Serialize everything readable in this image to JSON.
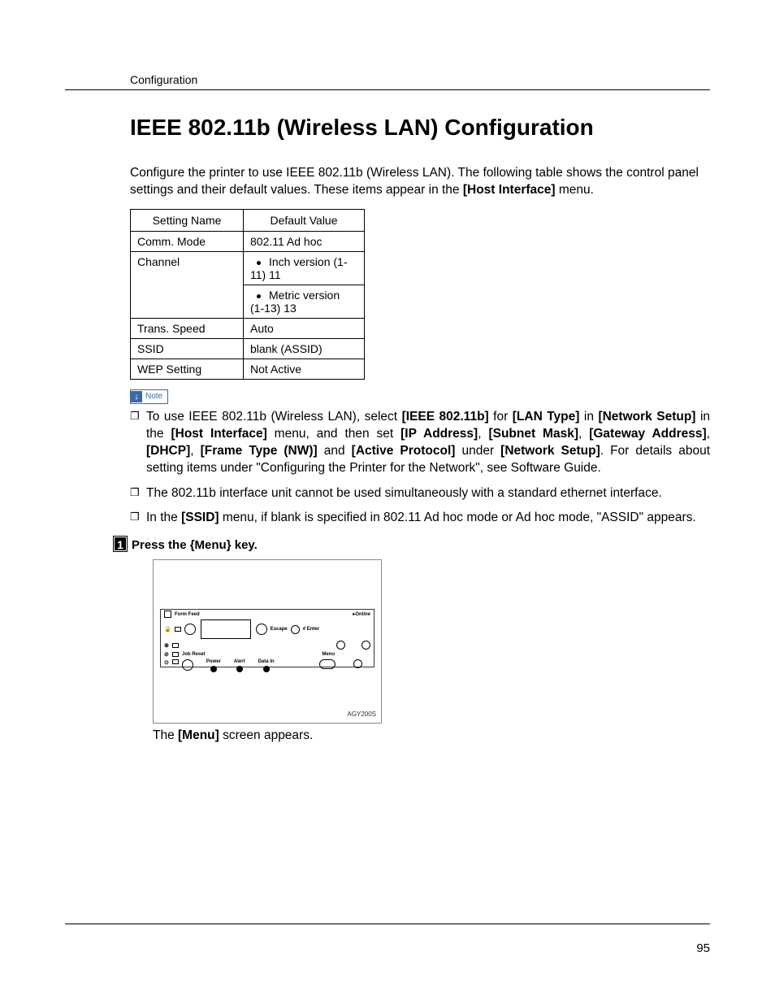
{
  "header": {
    "section": "Configuration"
  },
  "title": "IEEE 802.11b (Wireless LAN) Configuration",
  "intro": {
    "pre": "Configure the printer to use IEEE 802.11b (Wireless LAN). The following table shows the control panel settings and their default values. These items appear in the ",
    "bold": "[Host Interface]",
    "post": " menu."
  },
  "table": {
    "headers": [
      "Setting Name",
      "Default Value"
    ],
    "rows": [
      {
        "name": "Comm. Mode",
        "value": "802.11 Ad hoc"
      },
      {
        "name": "Channel",
        "bullets": [
          "Inch version (1-11) 11",
          "Metric version (1-13) 13"
        ]
      },
      {
        "name": "Trans. Speed",
        "value": "Auto"
      },
      {
        "name": "SSID",
        "value": "blank (ASSID)"
      },
      {
        "name": "WEP Setting",
        "value": "Not Active"
      }
    ]
  },
  "noteLabel": "Note",
  "notes": {
    "n1": {
      "parts": [
        "To use IEEE 802.11b (Wireless LAN), select ",
        "[IEEE 802.11b]",
        " for ",
        "[LAN Type]",
        " in ",
        "[Network Setup]",
        " in the ",
        "[Host Interface]",
        " menu, and then set ",
        "[IP Address]",
        ", ",
        "[Subnet Mask]",
        ", ",
        "[Gateway Address]",
        ", ",
        "[DHCP]",
        ", ",
        "[Frame Type (NW)]",
        " and ",
        "[Active Protocol]",
        " under ",
        "[Network Setup]",
        ". For details about setting items under \"Configuring the Printer for the Network\", see Software Guide."
      ],
      "boldIdx": [
        1,
        3,
        5,
        7,
        9,
        11,
        13,
        15,
        17,
        19,
        21
      ]
    },
    "n2": "The 802.11b interface unit cannot be used simultaneously with a standard ethernet interface.",
    "n3": {
      "parts": [
        "In the ",
        "[SSID]",
        " menu, if blank is specified in 802.11 Ad hoc mode or Ad hoc mode, \"ASSID\" appears."
      ],
      "boldIdx": [
        1
      ]
    }
  },
  "step1": {
    "num": "1",
    "pre": "Press the ",
    "key": "{Menu}",
    "post": " key."
  },
  "panel": {
    "labels": {
      "formFeed": "Form Feed",
      "jobReset": "Job Reset",
      "power": "Power",
      "alert": "Alert",
      "dataIn": "Data In",
      "online": "Online",
      "escape": "Escape",
      "enter": "# Enter",
      "menu": "Menu"
    },
    "code": "AGY200S"
  },
  "afterFigure": {
    "pre": "The ",
    "bold": "[Menu]",
    "post": " screen appears."
  },
  "pageNumber": "95"
}
